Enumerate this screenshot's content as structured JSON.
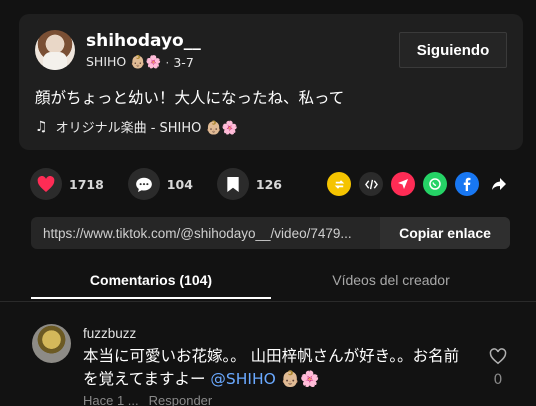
{
  "post": {
    "username": "shihodayo__",
    "display_name": "SHIHO 👶🏼🌸",
    "date": "3-7",
    "follow_label": "Siguiendo",
    "caption": "顔がちょっと幼い！大人になったね、私って",
    "music_icon": "♫",
    "music": "オリジナル楽曲 - SHIHO 👶🏼🌸"
  },
  "actions": {
    "likes": "1718",
    "comments": "104",
    "saves": "126"
  },
  "share": {
    "url": "https://www.tiktok.com/@shihodayo__/video/7479...",
    "copy_label": "Copiar enlace",
    "icons": [
      "repost-icon",
      "embed-icon",
      "send-icon",
      "whatsapp-icon",
      "facebook-icon",
      "more-share-icon"
    ],
    "colors": {
      "repost": "#f5c400",
      "embed": "#2b2b2b",
      "send": "#fe2c55",
      "whatsapp": "#25d366",
      "facebook": "#1877f2"
    }
  },
  "tabs": {
    "comments_label": "Comentarios (104)",
    "creator_label": "Vídeos del creador"
  },
  "comment": {
    "username": "fuzzbuzz",
    "text_main": "本当に可愛いお花嫁。。 山田梓帆さんが好き。。お名前を覚えてますよー ",
    "mention": "@SHIHO 👶🏼🌸",
    "time": "Hace 1 ...",
    "reply_label": "Responder",
    "like_count": "0"
  }
}
